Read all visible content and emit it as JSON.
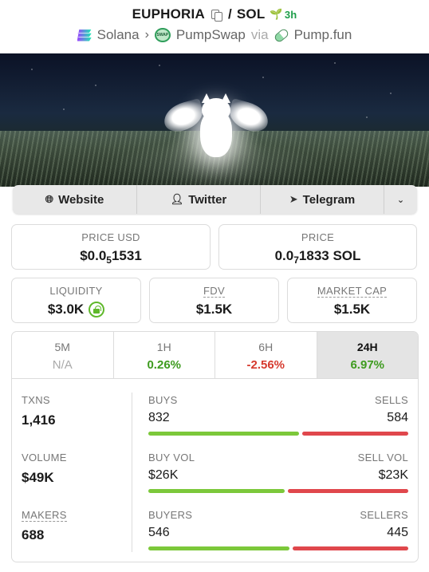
{
  "header": {
    "token_name": "EUPHORIA",
    "separator": "/",
    "quote": "SOL",
    "age": "3h",
    "chain": "Solana",
    "dex": "PumpSwap",
    "via": "via",
    "launchpad": "Pump.fun",
    "icons": [
      "copy-icon",
      "sprout-icon",
      "solana-icon",
      "chevron-right-icon",
      "pumpswap-icon",
      "pill-icon"
    ]
  },
  "links": [
    {
      "label": "Website",
      "icon": "globe-icon"
    },
    {
      "label": "Twitter",
      "icon": "user-icon"
    },
    {
      "label": "Telegram",
      "icon": "paper-plane-icon"
    },
    {
      "label": "",
      "icon": "chevron-down-icon"
    }
  ],
  "price_usd": {
    "label": "PRICE USD",
    "prefix": "$0.0",
    "zeros": "5",
    "digits": "1531"
  },
  "price_native": {
    "label": "PRICE",
    "prefix": "0.0",
    "zeros": "7",
    "digits": "1833 SOL"
  },
  "liquidity": {
    "label": "LIQUIDITY",
    "value": "$3.0K"
  },
  "fdv": {
    "label": "FDV",
    "value": "$1.5K"
  },
  "market_cap": {
    "label": "MARKET CAP",
    "value": "$1.5K"
  },
  "timeframes": [
    {
      "label": "5M",
      "value": "N/A",
      "status": "na"
    },
    {
      "label": "1H",
      "value": "0.26%",
      "status": "pos"
    },
    {
      "label": "6H",
      "value": "-2.56%",
      "status": "neg"
    },
    {
      "label": "24H",
      "value": "6.97%",
      "status": "pos",
      "active": true
    }
  ],
  "stats": {
    "txns": {
      "label": "TXNS",
      "value": "1,416"
    },
    "volume": {
      "label": "VOLUME",
      "value": "$49K"
    },
    "makers": {
      "label": "MAKERS",
      "value": "688"
    },
    "buys": {
      "label": "BUYS",
      "value": "832"
    },
    "sells": {
      "label": "SELLS",
      "value": "584"
    },
    "buy_vol": {
      "label": "BUY VOL",
      "value": "$26K"
    },
    "sell_vol": {
      "label": "SELL VOL",
      "value": "$23K"
    },
    "buyers": {
      "label": "BUYERS",
      "value": "546"
    },
    "sellers": {
      "label": "SELLERS",
      "value": "445"
    }
  },
  "colors": {
    "positive": "#3e9b1f",
    "negative": "#d63a2e",
    "buy_bar": "#7cc83a",
    "sell_bar": "#e0474c"
  }
}
